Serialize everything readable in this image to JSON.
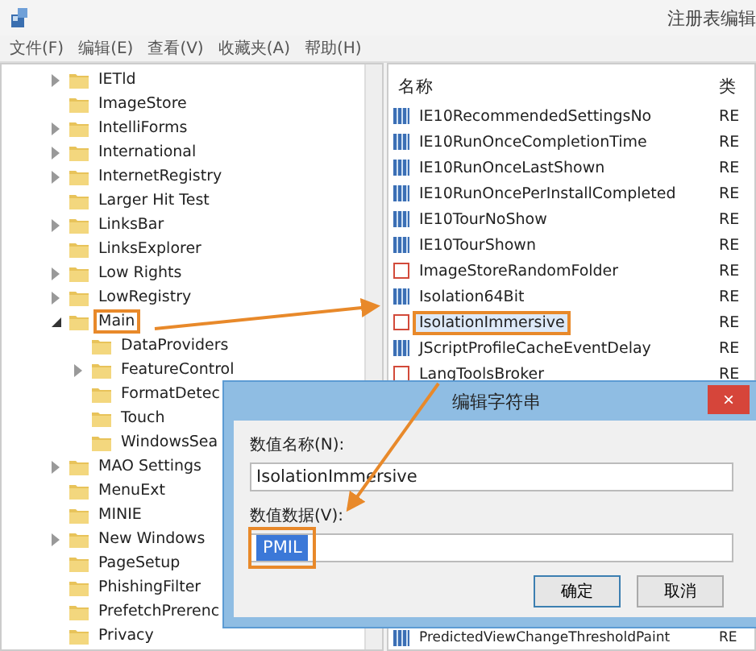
{
  "window": {
    "title": "注册表编辑"
  },
  "menu": [
    "文件(F)",
    "编辑(E)",
    "查看(V)",
    "收藏夹(A)",
    "帮助(H)"
  ],
  "tree": [
    {
      "label": "IETld",
      "expandable": true,
      "expanded": false,
      "highlighted": false
    },
    {
      "label": "ImageStore",
      "expandable": false,
      "highlighted": false
    },
    {
      "label": "IntelliForms",
      "expandable": true,
      "expanded": false,
      "highlighted": false
    },
    {
      "label": "International",
      "expandable": true,
      "expanded": false,
      "highlighted": false
    },
    {
      "label": "InternetRegistry",
      "expandable": true,
      "expanded": false,
      "highlighted": false
    },
    {
      "label": "Larger Hit Test",
      "expandable": false,
      "highlighted": false
    },
    {
      "label": "LinksBar",
      "expandable": true,
      "expanded": false,
      "highlighted": false
    },
    {
      "label": "LinksExplorer",
      "expandable": false,
      "highlighted": false
    },
    {
      "label": "Low Rights",
      "expandable": true,
      "expanded": false,
      "highlighted": false
    },
    {
      "label": "LowRegistry",
      "expandable": true,
      "expanded": false,
      "highlighted": false
    },
    {
      "label": "Main",
      "expandable": true,
      "expanded": true,
      "highlighted": true,
      "children": [
        {
          "label": "DataProviders",
          "expandable": false,
          "highlighted": false
        },
        {
          "label": "FeatureControl",
          "expandable": true,
          "expanded": false,
          "highlighted": false
        },
        {
          "label": "FormatDetec",
          "expandable": false,
          "highlighted": false
        },
        {
          "label": "Touch",
          "expandable": false,
          "highlighted": false
        },
        {
          "label": "WindowsSea",
          "expandable": false,
          "highlighted": false
        }
      ]
    },
    {
      "label": "MAO Settings",
      "expandable": true,
      "expanded": false,
      "highlighted": false
    },
    {
      "label": "MenuExt",
      "expandable": false,
      "highlighted": false
    },
    {
      "label": "MINIE",
      "expandable": false,
      "highlighted": false
    },
    {
      "label": "New Windows",
      "expandable": true,
      "expanded": false,
      "highlighted": false
    },
    {
      "label": "PageSetup",
      "expandable": false,
      "highlighted": false
    },
    {
      "label": "PhishingFilter",
      "expandable": false,
      "highlighted": false
    },
    {
      "label": "PrefetchPrerenc",
      "expandable": false,
      "highlighted": false
    },
    {
      "label": "Privacy",
      "expandable": false,
      "highlighted": false
    }
  ],
  "values": {
    "columns": [
      "名称",
      "类"
    ],
    "rows": [
      {
        "name": "IE10RecommendedSettingsNo",
        "type": "RE",
        "kind": "binary",
        "highlighted": false
      },
      {
        "name": "IE10RunOnceCompletionTime",
        "type": "RE",
        "kind": "binary",
        "highlighted": false
      },
      {
        "name": "IE10RunOnceLastShown",
        "type": "RE",
        "kind": "binary",
        "highlighted": false
      },
      {
        "name": "IE10RunOncePerInstallCompleted",
        "type": "RE",
        "kind": "binary",
        "highlighted": false
      },
      {
        "name": "IE10TourNoShow",
        "type": "RE",
        "kind": "binary",
        "highlighted": false
      },
      {
        "name": "IE10TourShown",
        "type": "RE",
        "kind": "binary",
        "highlighted": false
      },
      {
        "name": "ImageStoreRandomFolder",
        "type": "RE",
        "kind": "string",
        "highlighted": false
      },
      {
        "name": "Isolation64Bit",
        "type": "RE",
        "kind": "binary",
        "highlighted": false
      },
      {
        "name": "IsolationImmersive",
        "type": "RE",
        "kind": "string",
        "highlighted": true
      },
      {
        "name": "JScriptProfileCacheEventDelay",
        "type": "RE",
        "kind": "binary",
        "highlighted": false
      },
      {
        "name": "LangToolsBroker",
        "type": "RE",
        "kind": "string",
        "highlighted": false
      }
    ],
    "bottom_row": {
      "name": "PredictedViewChangeThresholdPaint",
      "type": "RE",
      "kind": "binary"
    }
  },
  "dialog": {
    "title": "编辑字符串",
    "close": "×",
    "name_label": "数值名称(N):",
    "name_value": "IsolationImmersive",
    "data_label": "数值数据(V):",
    "data_value": "PMIL",
    "data_highlighted": true,
    "buttons": [
      "确定",
      "取消"
    ]
  }
}
